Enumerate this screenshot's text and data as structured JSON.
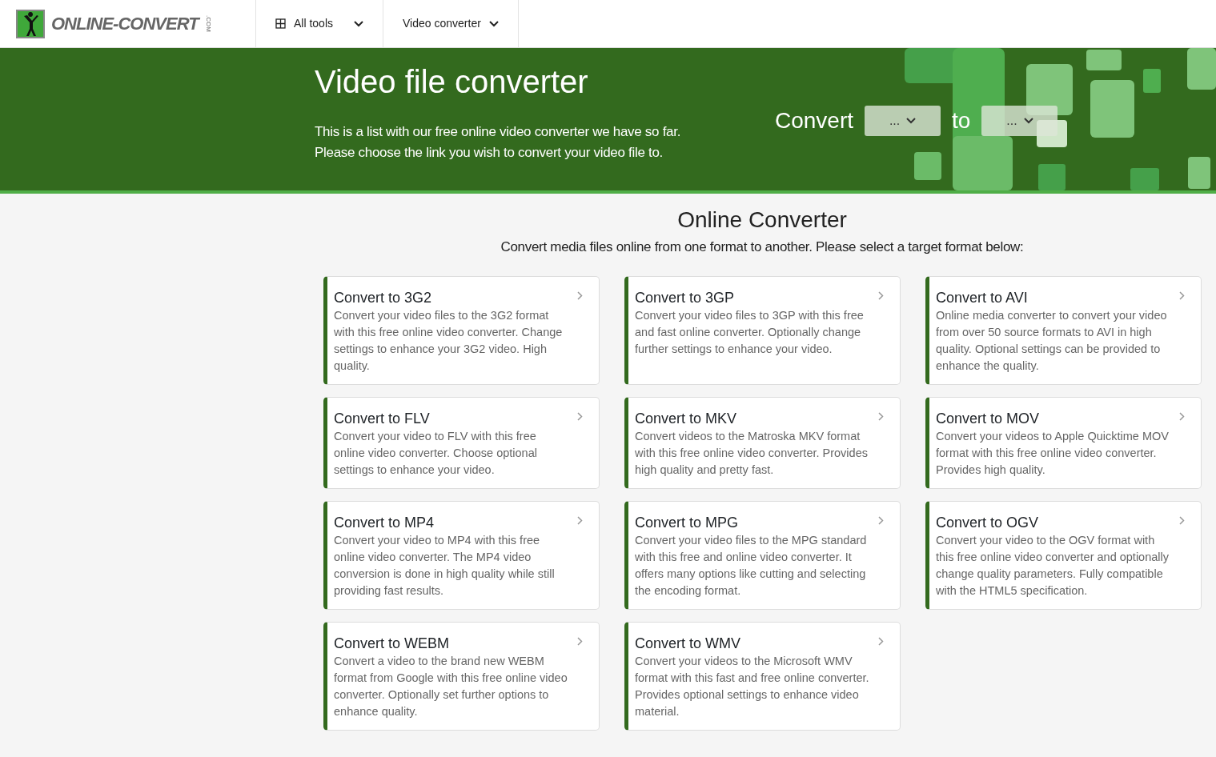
{
  "header": {
    "logo": {
      "text": "ONLINE-CONVERT",
      "suffix": ".COM"
    },
    "menus": [
      {
        "label": "All tools",
        "kind": "grid"
      },
      {
        "label": "Video converter",
        "kind": "plain"
      }
    ]
  },
  "banner": {
    "title": "Video file converter",
    "lines": [
      "This is a list with our free online video converter we have so far.",
      "Please choose the link you wish to convert your video file to."
    ],
    "convert_label": "Convert",
    "from_select": "...",
    "to_label": "to",
    "to_select": "..."
  },
  "section": {
    "title": "Online Converter",
    "subtitle": "Convert media files online from one format to another. Please select a target format below:"
  },
  "cards": [
    {
      "title": "Convert to 3G2",
      "text": "Convert your video files to the 3G2 format with this free online video converter. Change settings to enhance your 3G2 video. High quality."
    },
    {
      "title": "Convert to 3GP",
      "text": "Convert your video files to 3GP with this free and fast online converter. Optionally change further settings to enhance your video."
    },
    {
      "title": "Convert to AVI",
      "text": "Online media converter to convert your video from over 50 source formats to AVI in high quality. Optional settings can be provided to enhance the quality."
    },
    {
      "title": "Convert to FLV",
      "text": "Convert your video to FLV with this free online video converter. Choose optional settings to enhance your video."
    },
    {
      "title": "Convert to MKV",
      "text": "Convert videos to the Matroska MKV format with this free online video converter. Provides high quality and pretty fast."
    },
    {
      "title": "Convert to MOV",
      "text": "Convert your videos to Apple Quicktime MOV format with this free online video converter. Provides high quality."
    },
    {
      "title": "Convert to MP4",
      "text": "Convert your video to MP4 with this free online video converter. The MP4 video conversion is done in high quality while still providing fast results."
    },
    {
      "title": "Convert to MPG",
      "text": "Convert your video files to the MPG standard with this free and online video converter. It offers many options like cutting and selecting the encoding format."
    },
    {
      "title": "Convert to OGV",
      "text": "Convert your video to the OGV format with this free online video converter and optionally change quality parameters. Fully compatible with the HTML5 specification."
    },
    {
      "title": "Convert to WEBM",
      "text": "Convert a video to the brand new WEBM format from Google with this free online video converter. Optionally set further options to enhance quality."
    },
    {
      "title": "Convert to WMV",
      "text": "Convert your videos to the Microsoft WMV format with this fast and free online converter. Provides optional settings to enhance video material."
    }
  ]
}
